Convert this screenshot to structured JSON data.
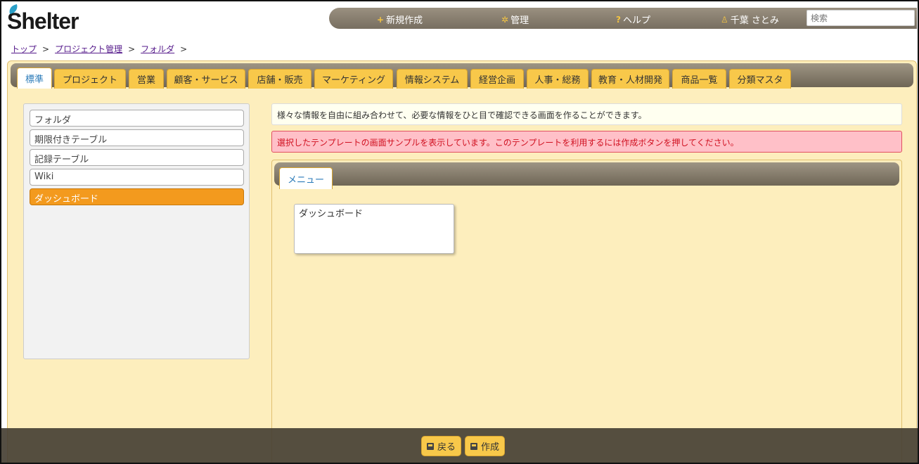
{
  "app": {
    "logo_text": "Shelter"
  },
  "topnav": {
    "new_label": "新規作成",
    "admin_label": "管理",
    "help_label": "ヘルプ",
    "user_label": "千葉 さとみ",
    "search_placeholder": "検索"
  },
  "breadcrumb": {
    "items": [
      "トップ",
      "プロジェクト管理",
      "フォルダ"
    ],
    "separator": ">"
  },
  "tabs": [
    {
      "label": "標準",
      "active": true
    },
    {
      "label": "プロジェクト"
    },
    {
      "label": "営業"
    },
    {
      "label": "顧客・サービス"
    },
    {
      "label": "店舗・販売"
    },
    {
      "label": "マーケティング"
    },
    {
      "label": "情報システム"
    },
    {
      "label": "経営企画"
    },
    {
      "label": "人事・総務"
    },
    {
      "label": "教育・人材開発"
    },
    {
      "label": "商品一覧"
    },
    {
      "label": "分類マスタ"
    }
  ],
  "sidebar": {
    "items": [
      {
        "label": "フォルダ"
      },
      {
        "label": "期限付きテーブル"
      },
      {
        "label": "記録テーブル"
      },
      {
        "label": "Wiki"
      },
      {
        "label": "ダッシュボード",
        "active": true
      }
    ]
  },
  "info_text": "様々な情報を自由に組み合わせて、必要な情報をひと目で確認できる画面を作ることができます。",
  "alert_text": "選択したテンプレートの画面サンプルを表示しています。このテンプレートを利用するには作成ボタンを押してください。",
  "content": {
    "subtab_label": "メニュー",
    "widget_label": "ダッシュボード"
  },
  "footer": {
    "back_label": "戻る",
    "create_label": "作成"
  },
  "colors": {
    "accent": "#f8c84a",
    "active_item": "#f39a1e",
    "alert_bg": "#ffc0c8",
    "alert_text": "#d01020",
    "panel_bg": "#fdeebd"
  }
}
